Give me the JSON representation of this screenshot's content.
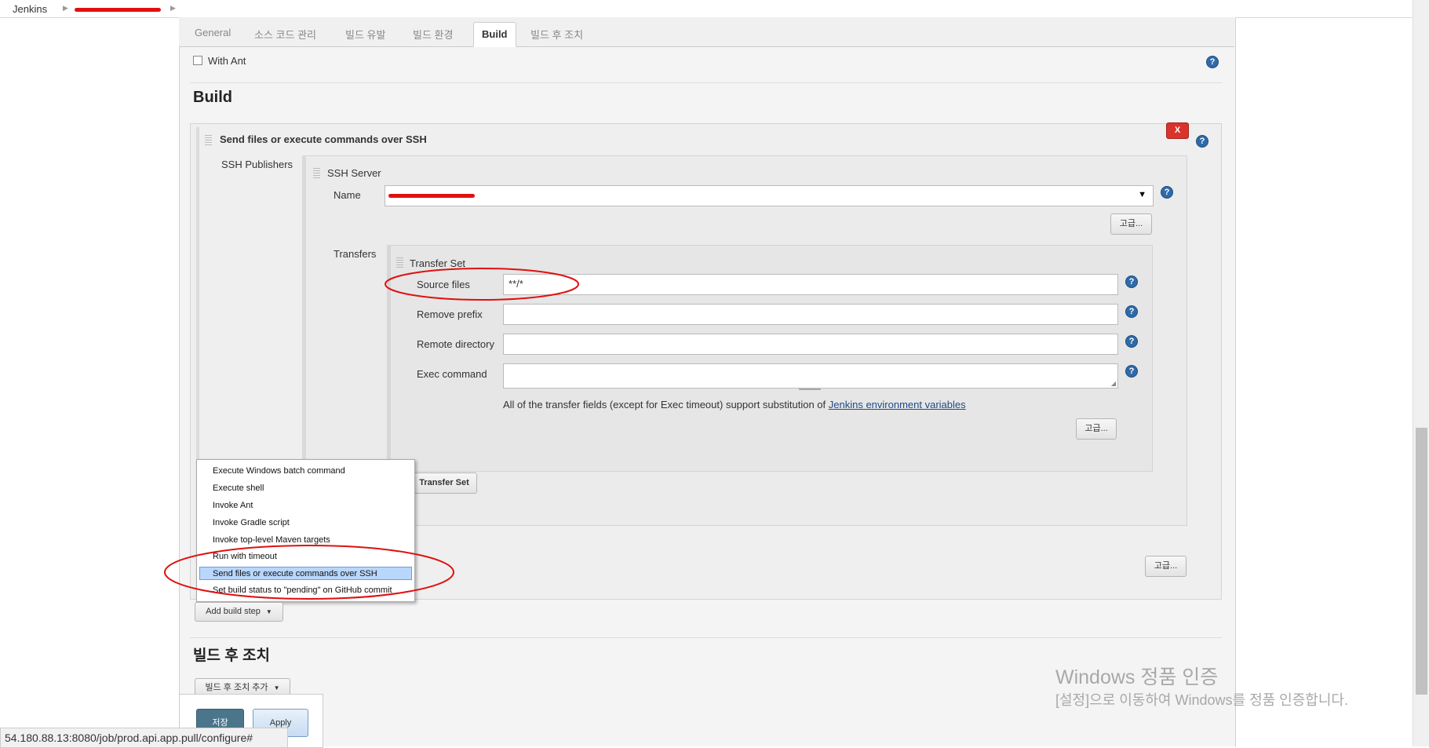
{
  "breadcrumb": {
    "root": "Jenkins"
  },
  "tabs": [
    "General",
    "소스 코드 관리",
    "빌드 유발",
    "빌드 환경",
    "Build",
    "빌드 후 조치"
  ],
  "active_tab": "Build",
  "with_ant_label": "With Ant",
  "build_heading": "Build",
  "step_title": "Send files or execute commands over SSH",
  "delete_label": "X",
  "ssh_publishers_label": "SSH Publishers",
  "ssh_server_label": "SSH Server",
  "name_label": "Name",
  "advanced_label": "고급...",
  "transfers_label": "Transfers",
  "transfer_set_label": "Transfer Set",
  "source_files_label": "Source files",
  "source_files_value": "**/*",
  "remove_prefix_label": "Remove prefix",
  "remote_directory_label": "Remote directory",
  "exec_command_label": "Exec command",
  "substitution_note": "All of the transfer fields (except for Exec timeout) support substitution of ",
  "env_vars_link": "Jenkins environment variables",
  "add_transfer_set_label": "Transfer Set",
  "menu_items": [
    "Execute Windows batch command",
    "Execute shell",
    "Invoke Ant",
    "Invoke Gradle script",
    "Invoke top-level Maven targets",
    "Run with timeout",
    "Send files or execute commands over SSH",
    "Set build status to \"pending\" on GitHub commit"
  ],
  "selected_menu_item": "Send files or execute commands over SSH",
  "add_build_step_label": "Add build step",
  "post_build_heading": "빌드 후 조치",
  "add_post_build_label": "빌드 후 조치 추가",
  "save_label": "저장",
  "apply_label": "Apply",
  "status_url": "54.180.88.13:8080/job/prod.api.app.pull/configure#",
  "watermark_title": "Windows 정품 인증",
  "watermark_sub": "[설정]으로 이동하여 Windows를 정품 인증합니다.",
  "colors": {
    "help": "#2f6aa9",
    "delete": "#d9342b",
    "annotation": "#e01010",
    "link": "#204a87"
  }
}
